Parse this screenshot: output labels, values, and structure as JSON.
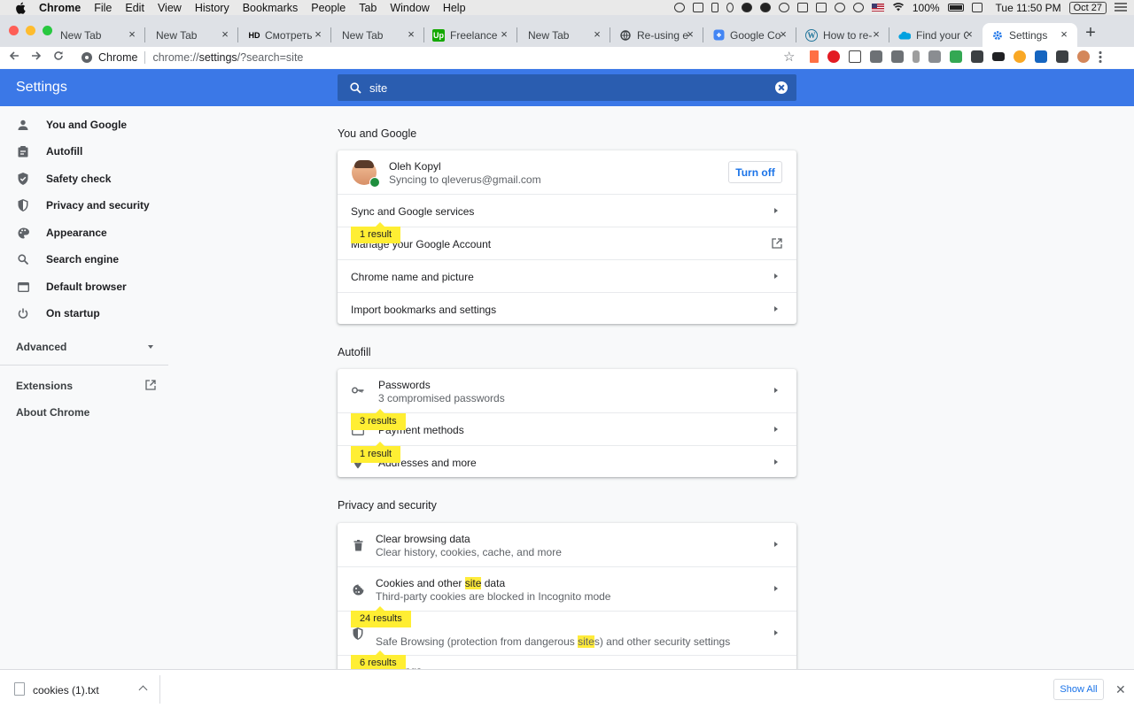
{
  "menubar": {
    "app": "Chrome",
    "items": [
      "File",
      "Edit",
      "View",
      "History",
      "Bookmarks",
      "People",
      "Tab",
      "Window",
      "Help"
    ],
    "battery": "100%",
    "time": "Tue 11:50 PM",
    "date": "Oct 27"
  },
  "tabs": [
    {
      "label": "New Tab",
      "icon": "blank-icon"
    },
    {
      "label": "New Tab",
      "icon": "blank-icon"
    },
    {
      "label": "Смотреть се",
      "icon": "hd-icon",
      "icon_text": "HD"
    },
    {
      "label": "New Tab",
      "icon": "blank-icon"
    },
    {
      "label": "Freelance (u",
      "icon": "upwork-icon",
      "icon_text": "Up"
    },
    {
      "label": "New Tab",
      "icon": "blank-icon"
    },
    {
      "label": "Re-using exi",
      "icon": "globe-icon"
    },
    {
      "label": "Google Code",
      "icon": "google-code-icon"
    },
    {
      "label": "How to re-u",
      "icon": "wordpress-icon",
      "icon_text": "W"
    },
    {
      "label": "Find your Co",
      "icon": "salesforce-cloud-icon"
    },
    {
      "label": "Settings",
      "icon": "gear-icon"
    }
  ],
  "omnibox": {
    "chip": "Chrome",
    "url_prefix": "chrome://",
    "url_host": "settings",
    "url_rest": "/?search=site"
  },
  "header": {
    "title": "Settings",
    "search_value": "site"
  },
  "sidebar": {
    "items": [
      {
        "label": "You and Google",
        "icon": "person-icon"
      },
      {
        "label": "Autofill",
        "icon": "clipboard-icon"
      },
      {
        "label": "Safety check",
        "icon": "shield-check-icon"
      },
      {
        "label": "Privacy and security",
        "icon": "shield-icon"
      },
      {
        "label": "Appearance",
        "icon": "palette-icon"
      },
      {
        "label": "Search engine",
        "icon": "search-icon"
      },
      {
        "label": "Default browser",
        "icon": "browser-icon"
      },
      {
        "label": "On startup",
        "icon": "power-icon"
      }
    ],
    "advanced": "Advanced",
    "extensions": "Extensions",
    "about": "About Chrome"
  },
  "you_and_google": {
    "title": "You and Google",
    "account_name": "Oleh Kopyl",
    "account_sync": "Syncing to qleverus@gmail.com",
    "turn_off": "Turn off",
    "rows": [
      {
        "label": "Sync and Google services"
      },
      {
        "label": "Manage your Google Account"
      },
      {
        "label": "Chrome name and picture"
      },
      {
        "label": "Import bookmarks and settings"
      }
    ],
    "bubbles": [
      "1 result"
    ]
  },
  "autofill": {
    "title": "Autofill",
    "passwords_label": "Passwords",
    "passwords_sub": "3 compromised passwords",
    "payment_label": "Payment methods",
    "addresses_label": "Addresses and more",
    "bubbles": [
      "3 results",
      "1 result"
    ]
  },
  "privacy": {
    "title": "Privacy and security",
    "clear_label": "Clear browsing data",
    "clear_sub": "Clear history, cookies, cache, and more",
    "cookies_label_a": "Cookies and other ",
    "cookies_label_hl": "site",
    "cookies_label_b": " data",
    "cookies_sub": "Third-party cookies are blocked in Incognito mode",
    "security_sub_a": "Safe Browsing (protection from dangerous ",
    "security_sub_hl": "site",
    "security_sub_b": "s) and other security settings",
    "site_settings_partial": "ings",
    "bubbles": [
      "24 results",
      "6 results"
    ]
  },
  "download": {
    "filename": "cookies (1).txt",
    "show_all": "Show All"
  },
  "colors": {
    "header_blue": "#3b78e7",
    "search_blue": "#2a5db0",
    "highlight": "#ffeb3b",
    "link_blue": "#1a73e8"
  }
}
